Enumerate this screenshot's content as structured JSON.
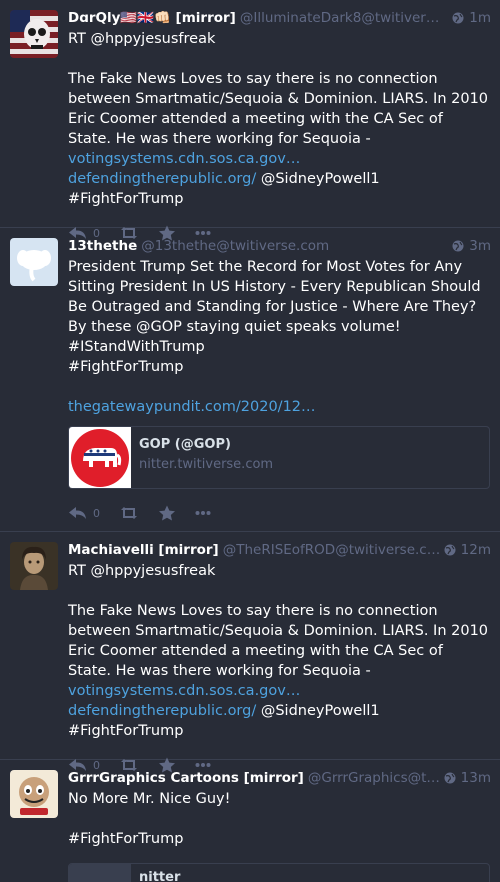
{
  "statuses": [
    {
      "display_name": "DɑrQly🇺🇸🇬🇧👊🏻 [mirror]",
      "handle": "@IlluminateDark8@twitiverse.co…",
      "time": "1m",
      "avatar": "skull-flag-avatar",
      "lines": [
        {
          "t": "RT @hppyjesusfreak"
        },
        {
          "gap": true
        },
        {
          "t": "The Fake News Loves to say there is no connection between Smartmatic/Sequoia & Dominion. LIARS. In 2010 Eric Coomer attended a meeting with the CA Sec of State. He was there working for Sequoia - ",
          "link": "votingsystems.cdn.sos.ca.gov…"
        },
        {
          "link": "defendingtherepublic.org/",
          "t2": " @SidneyPowell1"
        },
        {
          "t": "#FightForTrump"
        }
      ],
      "reply_count": "0"
    },
    {
      "display_name": "13thethe",
      "handle": "@13thethe@twitiverse.com",
      "time": "3m",
      "avatar": "elephant-avatar",
      "lines": [
        {
          "t": "President Trump Set the Record for Most Votes for Any Sitting President In US History - Every Republican Should Be Outraged and Standing for Justice - Where Are They?"
        },
        {
          "t": "By these @GOP staying quiet speaks volume!"
        },
        {
          "t": "#IStandWithTrump"
        },
        {
          "t": "#FightForTrump"
        },
        {
          "gap": true
        },
        {
          "link": "thegatewaypundit.com/2020/12…"
        }
      ],
      "card": {
        "title": "GOP (@GOP)",
        "host": "nitter.twitiverse.com",
        "image": "gop-elephant-logo"
      },
      "reply_count": "0"
    },
    {
      "display_name": "Machiavelli [mirror]",
      "handle": "@TheRISEofROD@twitiverse.com",
      "time": "12m",
      "avatar": "portrait-avatar",
      "lines": [
        {
          "t": "RT @hppyjesusfreak"
        },
        {
          "gap": true
        },
        {
          "t": "The Fake News Loves to say there is no connection between Smartmatic/Sequoia & Dominion. LIARS. In 2010 Eric Coomer attended a meeting with the CA Sec of State. He was there working for Sequoia - ",
          "link": "votingsystems.cdn.sos.ca.gov…"
        },
        {
          "link": "defendingtherepublic.org/",
          "t2": " @SidneyPowell1"
        },
        {
          "t": "#FightForTrump"
        }
      ],
      "reply_count": "0"
    },
    {
      "display_name": "GrrrGraphics Cartoons [mirror]",
      "handle": "@GrrrGraphics@twitivers…",
      "time": "13m",
      "avatar": "cartoon-logo-avatar",
      "lines": [
        {
          "t": "No More Mr. Nice Guy!"
        },
        {
          "gap": true
        },
        {
          "t": "#FightForTrump"
        }
      ],
      "card_partial": {
        "title": "nitter"
      }
    }
  ],
  "colors": {
    "background": "#282c37",
    "link": "#4ea2df",
    "muted": "#606984",
    "border": "#393f4f"
  }
}
